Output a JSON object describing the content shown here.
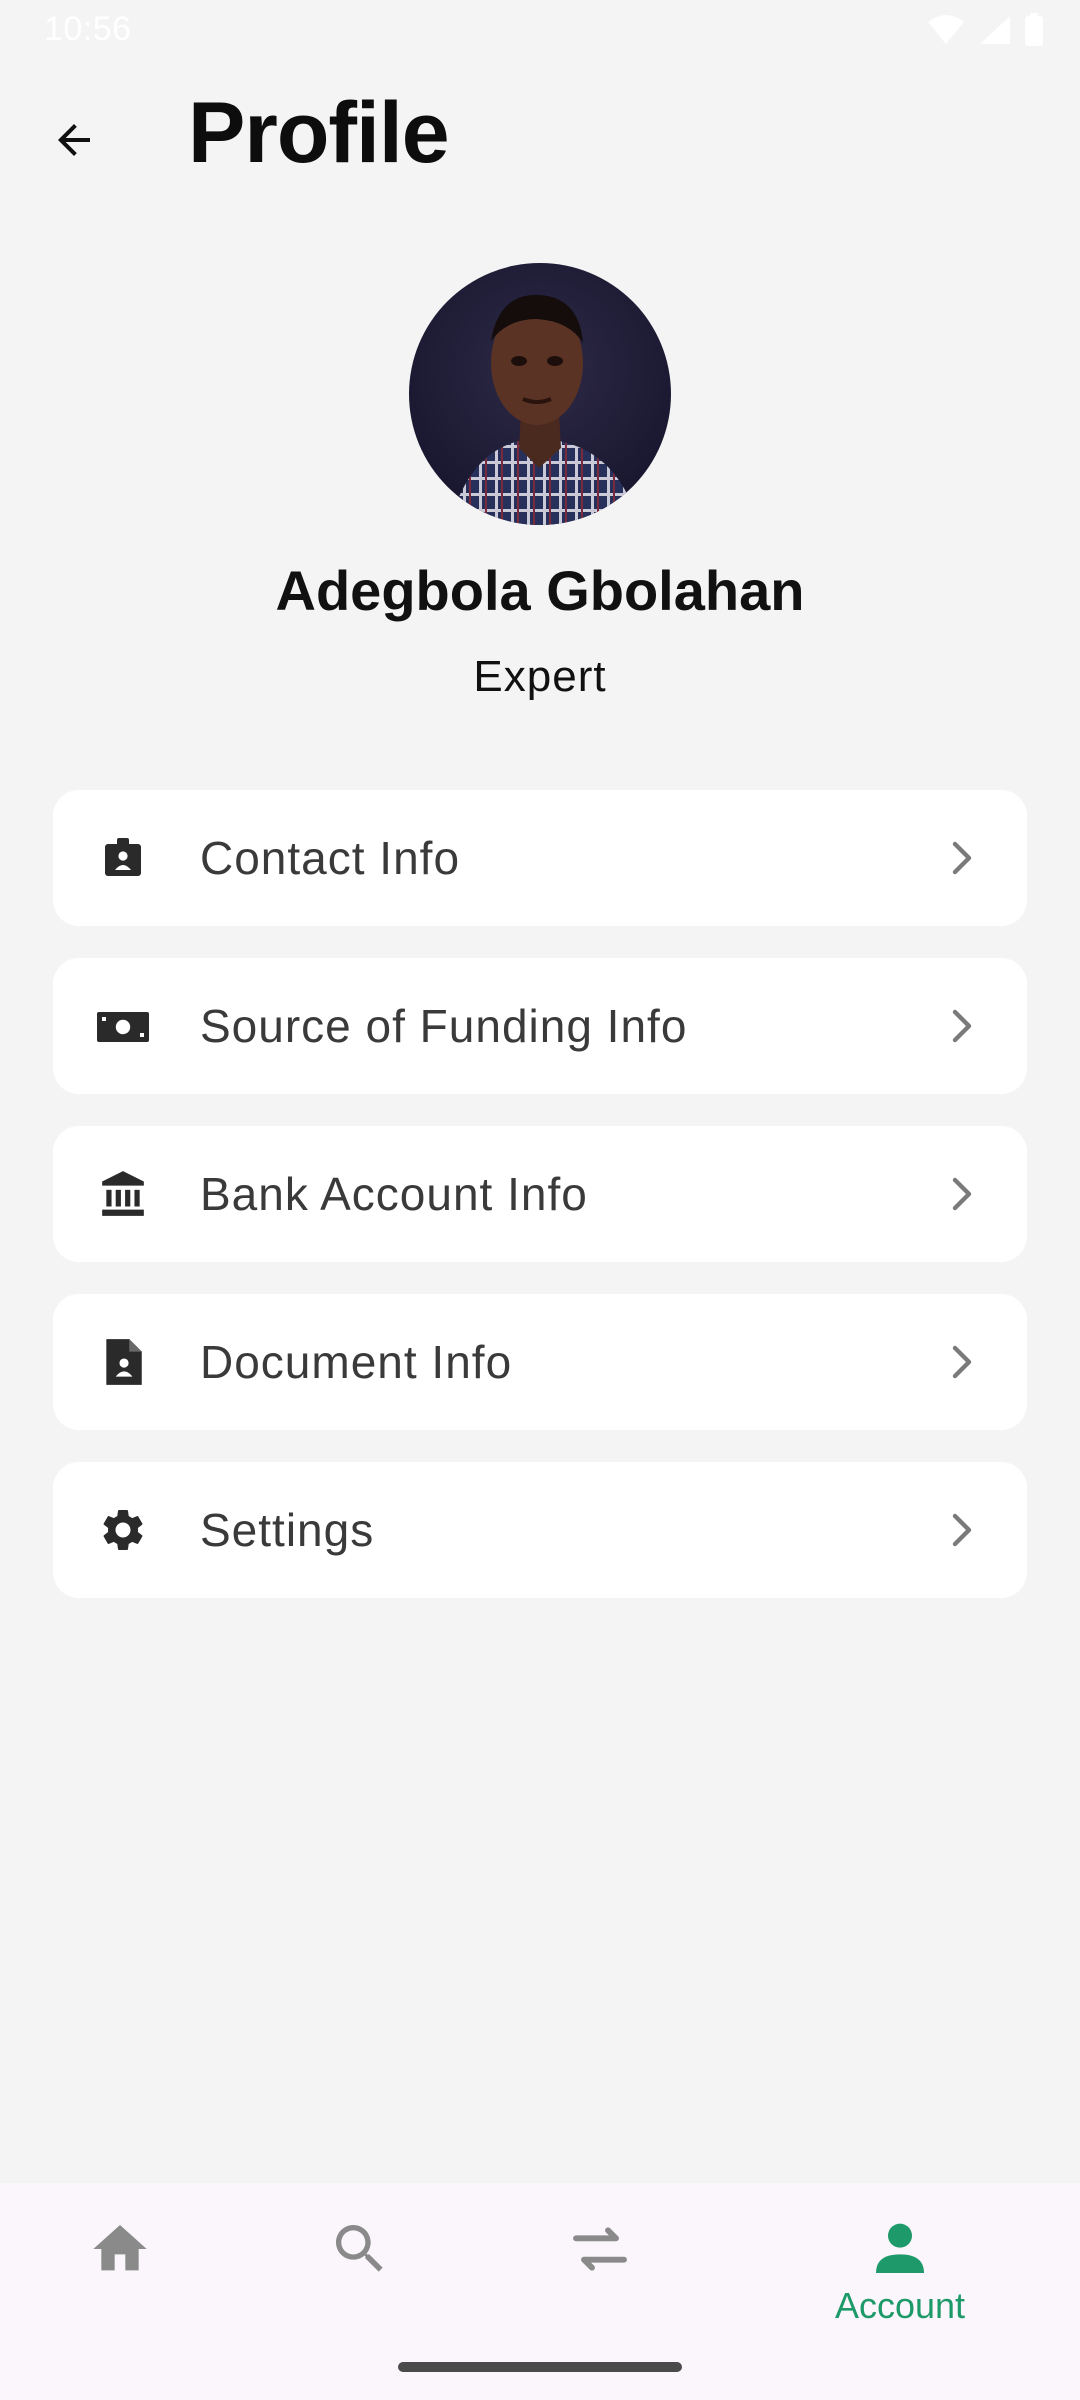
{
  "status_bar": {
    "time": "10:56",
    "icons": [
      "wifi-icon",
      "cellular-signal-icon",
      "battery-icon"
    ]
  },
  "header": {
    "title": "Profile",
    "back_icon": "arrow-left-icon"
  },
  "profile": {
    "name": "Adegbola Gbolahan",
    "role": "Expert"
  },
  "menu": {
    "items": [
      {
        "label": "Contact Info",
        "icon": "contact-badge-icon"
      },
      {
        "label": "Source of Funding Info",
        "icon": "cash-icon"
      },
      {
        "label": "Bank Account Info",
        "icon": "bank-icon"
      },
      {
        "label": "Document Info",
        "icon": "document-icon"
      },
      {
        "label": "Settings",
        "icon": "gear-icon"
      }
    ]
  },
  "bottom_nav": {
    "items": [
      {
        "icon": "home-icon",
        "label": ""
      },
      {
        "icon": "search-icon",
        "label": ""
      },
      {
        "icon": "transfer-icon",
        "label": ""
      },
      {
        "icon": "account-icon",
        "label": "Account",
        "active": true
      }
    ]
  },
  "colors": {
    "background": "#f4f4f4",
    "card": "#ffffff",
    "accent": "#1e9a6a",
    "inactive_icon": "#8a8a8a",
    "nav_background": "#fbf6fb"
  }
}
